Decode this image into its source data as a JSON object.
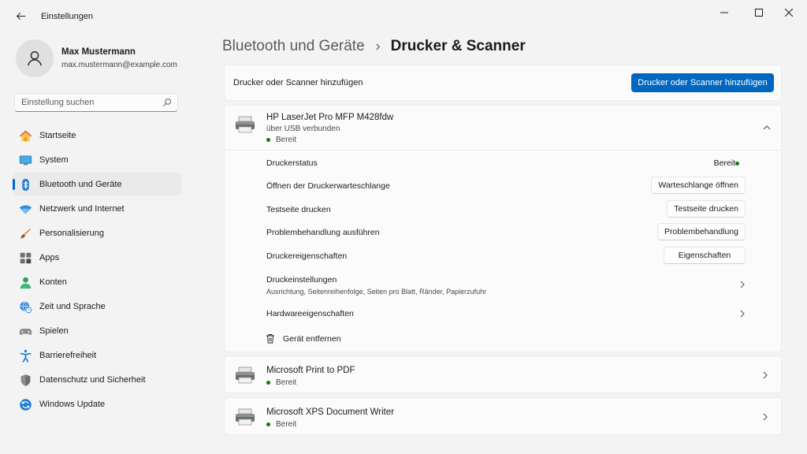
{
  "window": {
    "title": "Einstellungen"
  },
  "profile": {
    "name": "Max Mustermann",
    "email": "max.mustermann@example.com"
  },
  "search": {
    "placeholder": "Einstellung suchen"
  },
  "nav": {
    "items": [
      {
        "label": "Startseite",
        "icon": "home-icon"
      },
      {
        "label": "System",
        "icon": "monitor-icon"
      },
      {
        "label": "Bluetooth und Geräte",
        "icon": "bluetooth-icon",
        "active": true
      },
      {
        "label": "Netzwerk und Internet",
        "icon": "wifi-icon"
      },
      {
        "label": "Personalisierung",
        "icon": "brush-icon"
      },
      {
        "label": "Apps",
        "icon": "apps-icon"
      },
      {
        "label": "Konten",
        "icon": "account-icon"
      },
      {
        "label": "Zeit und Sprache",
        "icon": "globe-clock-icon"
      },
      {
        "label": "Spielen",
        "icon": "gamepad-icon"
      },
      {
        "label": "Barrierefreiheit",
        "icon": "accessibility-icon"
      },
      {
        "label": "Datenschutz und Sicherheit",
        "icon": "shield-icon"
      },
      {
        "label": "Windows Update",
        "icon": "update-icon"
      }
    ]
  },
  "header": {
    "parent": "Bluetooth und Geräte",
    "current": "Drucker & Scanner"
  },
  "add_device": {
    "label": "Drucker oder Scanner hinzufügen",
    "button": "Drucker oder Scanner hinzufügen"
  },
  "printers": [
    {
      "name": "HP LaserJet Pro MFP M428fdw",
      "connection": "über USB verbunden",
      "status": "Bereit",
      "expanded": true,
      "details": {
        "status_label": "Druckerstatus",
        "status_value": "Bereit",
        "queue_label": "Öffnen der Druckerwarteschlange",
        "queue_button": "Warteschlange öffnen",
        "testpage_label": "Testseite drucken",
        "testpage_button": "Testseite drucken",
        "troubleshoot_label": "Problembehandlung ausführen",
        "troubleshoot_button": "Problembehandlung",
        "properties_label": "Druckereigenschaften",
        "properties_button": "Eigenschaften",
        "preferences_label": "Druckeinstellungen",
        "preferences_sub": "Ausrichtung, Seitenreihenfolge, Seiten pro Blatt, Ränder, Papierzufuhr",
        "hardware_label": "Hardwareeigenschaften",
        "remove_label": "Gerät entfernen"
      }
    },
    {
      "name": "Microsoft Print to PDF",
      "status": "Bereit"
    },
    {
      "name": "Microsoft XPS Document Writer",
      "status": "Bereit"
    }
  ],
  "colors": {
    "accent": "#0067c0",
    "status_ready": "#0f7b0f",
    "background": "#f3f3f3",
    "card": "#fbfbfb"
  }
}
